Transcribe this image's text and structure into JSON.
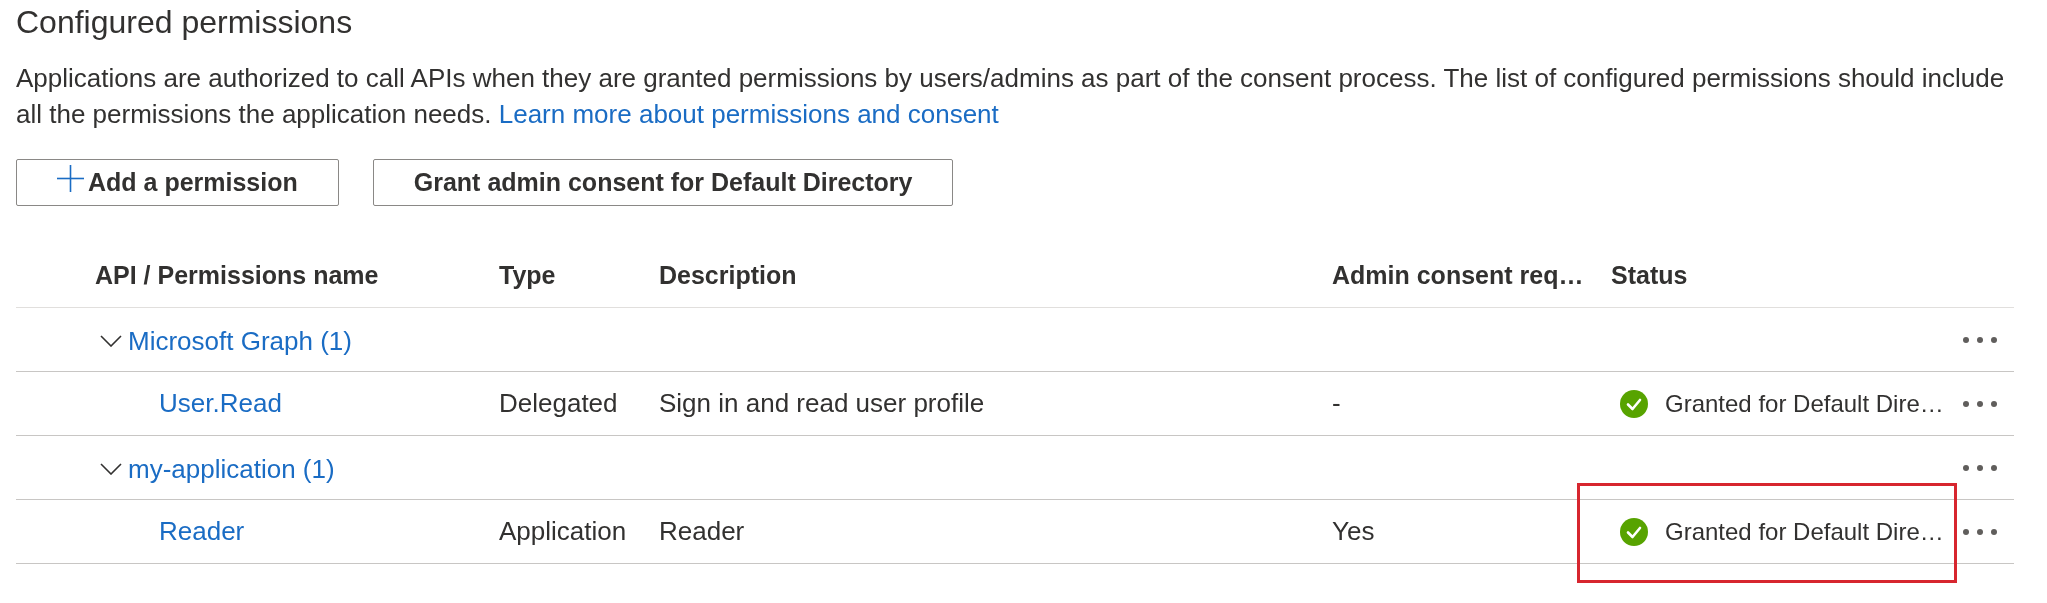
{
  "section": {
    "title": "Configured permissions",
    "description": "Applications are authorized to call APIs when they are granted permissions by users/admins as part of the consent process. The list of configured permissions should include all the permissions the application needs.",
    "link": "Learn more about permissions and consent"
  },
  "toolbar": {
    "buttons": [
      {
        "label": "Add a permission",
        "kind": "add"
      },
      {
        "label": "Grant admin consent for Default Directory",
        "kind": "plain"
      }
    ]
  },
  "table": {
    "columns": [
      "API / Permissions name",
      "Type",
      "Description",
      "Admin consent req…",
      "Status"
    ],
    "groups": [
      {
        "name": "Microsoft Graph (1)",
        "expanded": true,
        "permissions": [
          {
            "name": "User.Read",
            "type": "Delegated",
            "description": "Sign in and read user profile",
            "admin_consent_required": "-",
            "status": "Granted for Default Dire…",
            "granted": true,
            "highlighted": false
          }
        ]
      },
      {
        "name": "my-application (1)",
        "expanded": true,
        "permissions": [
          {
            "name": "Reader",
            "type": "Application",
            "description": "Reader",
            "admin_consent_required": "Yes",
            "status": "Granted for Default Dire…",
            "granted": true,
            "highlighted": true
          }
        ]
      }
    ]
  }
}
